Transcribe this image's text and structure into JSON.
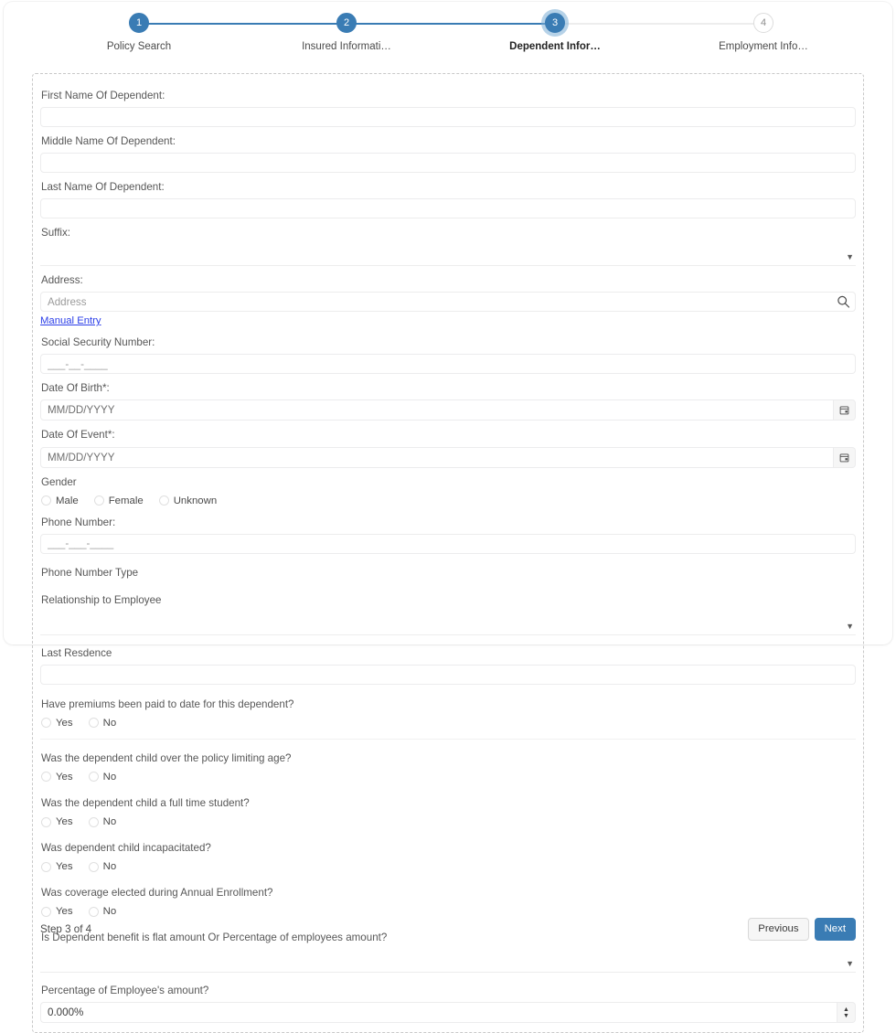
{
  "stepper": {
    "steps": [
      {
        "number": "1",
        "label": "Policy Search",
        "state": "done"
      },
      {
        "number": "2",
        "label": "Insured Informati…",
        "state": "done"
      },
      {
        "number": "3",
        "label": "Dependent Infor…",
        "state": "active"
      },
      {
        "number": "4",
        "label": "Employment Info…",
        "state": "todo"
      }
    ]
  },
  "form": {
    "first_name_label": "First Name Of Dependent:",
    "first_name_value": "",
    "middle_name_label": "Middle Name Of Dependent:",
    "middle_name_value": "",
    "last_name_label": "Last Name Of Dependent:",
    "last_name_value": "",
    "suffix_label": "Suffix:",
    "suffix_value": "",
    "address_label": "Address:",
    "address_placeholder": "Address",
    "address_value": "",
    "manual_entry_link": "Manual Entry",
    "ssn_label": "Social Security Number:",
    "ssn_placeholder": "___-__-____",
    "ssn_value": "",
    "dob_label": "Date Of Birth*:",
    "dob_placeholder": "MM/DD/YYYY",
    "dob_value": "",
    "doe_label": "Date Of Event*:",
    "doe_placeholder": "MM/DD/YYYY",
    "doe_value": "",
    "gender_label": "Gender",
    "gender_options": [
      "Male",
      "Female",
      "Unknown"
    ],
    "phone_label": "Phone Number:",
    "phone_placeholder": "___-___-____",
    "phone_value": "",
    "phone_type_label": "Phone Number Type",
    "relationship_label": "Relationship to Employee",
    "relationship_value": "",
    "last_residence_label": "Last Resdence",
    "last_residence_value": "",
    "yes_no": [
      "Yes",
      "No"
    ],
    "questions": [
      {
        "label": "Have premiums been paid to date for this dependent?",
        "divider_after": true
      },
      {
        "label": "Was the dependent child over the policy limiting age?",
        "divider_after": false
      },
      {
        "label": "Was the dependent child a full time student?",
        "divider_after": false
      },
      {
        "label": "Was dependent child incapacitated?",
        "divider_after": false
      },
      {
        "label": "Was coverage elected during Annual Enrollment?",
        "divider_after": false
      }
    ],
    "benefit_type_label": "Is Dependent benefit is flat amount Or Percentage of employees amount?",
    "benefit_type_value": "",
    "percentage_label": "Percentage of Employee's amount?",
    "percentage_value": "0.000%"
  },
  "footer": {
    "step_counter": "Step 3 of 4",
    "previous_label": "Previous",
    "next_label": "Next"
  },
  "icons": {
    "search": "search-icon",
    "calendar": "calendar-icon",
    "caret_down": "▼",
    "spin_up": "▲",
    "spin_down": "▼"
  },
  "colors": {
    "accent": "#3a7cb4",
    "link": "#2b3ee8",
    "label_text": "#575757"
  }
}
